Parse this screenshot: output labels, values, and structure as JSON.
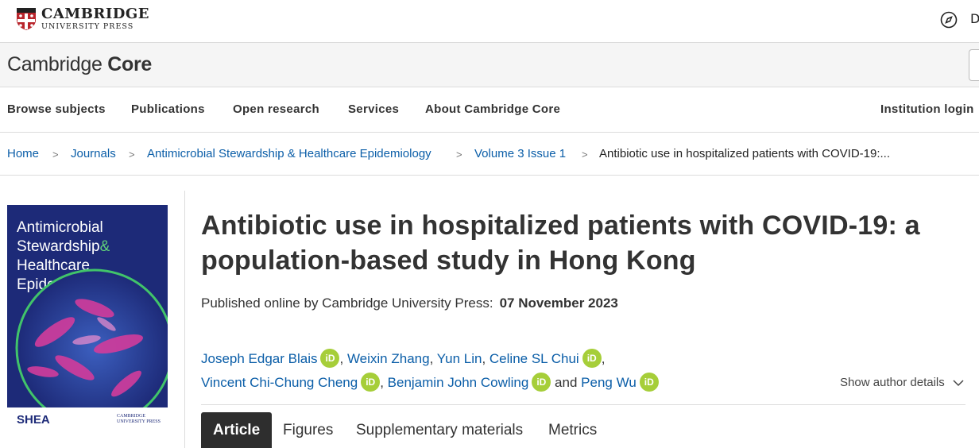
{
  "header": {
    "publisher_line1": "CAMBRIDGE",
    "publisher_line2": "UNIVERSITY PRESS",
    "right_partial": "D"
  },
  "core": {
    "brand_light": "Cambridge",
    "brand_bold": "Core"
  },
  "nav": {
    "items": [
      "Browse subjects",
      "Publications",
      "Open research",
      "Services",
      "About Cambridge Core"
    ],
    "institution_login": "Institution login"
  },
  "breadcrumb": {
    "home": "Home",
    "journals": "Journals",
    "journal": "Antimicrobial Stewardship & Healthcare Epidemiology",
    "issue": "Volume 3 Issue 1",
    "current": "Antibiotic use in hospitalized patients with COVID-19:...",
    "separator": ">"
  },
  "cover": {
    "line1": "Antimicrobial",
    "line2": "Stewardship",
    "amp": "&",
    "line3": "Healthcare",
    "line4": "Epidemiology",
    "society": "SHEA",
    "press_line1": "CAMBRIDGE",
    "press_line2": "UNIVERSITY PRESS"
  },
  "article": {
    "title": "Antibiotic use in hospitalized patients with COVID-19: a population-based study in Hong Kong",
    "published_label": "Published online by Cambridge University Press:",
    "published_date": "07 November 2023",
    "authors": [
      "Joseph Edgar Blais",
      "Weixin Zhang",
      "Yun Lin",
      "Celine SL Chui",
      "Vincent Chi-Chung Cheng",
      "Benjamin John Cowling",
      "Peng Wu"
    ],
    "orcid_label": "iD",
    "and_word": "and",
    "show_author_details": "Show author details"
  },
  "tabs": [
    "Article",
    "Figures",
    "Supplementary materials",
    "Metrics"
  ],
  "colors": {
    "link": "#0b5ea8",
    "orcid": "#a6ce39",
    "cover_bg": "#1d2a78",
    "tab_active": "#2e2e2e"
  }
}
